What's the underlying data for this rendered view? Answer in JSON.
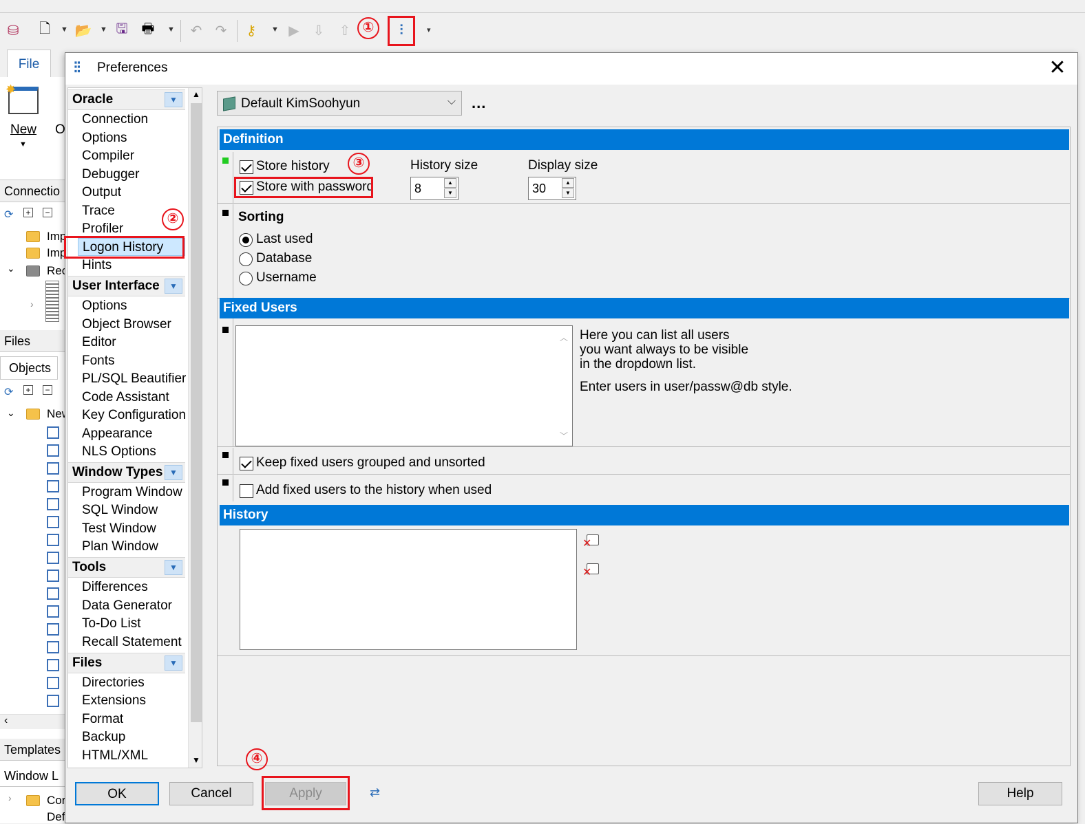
{
  "ribbon": {
    "file_tab": "File",
    "new_label": "New",
    "open_label_fragment": "O"
  },
  "left_panel": {
    "connections_title": "Connectio",
    "files_title": "Files",
    "objects_tab": "Objects",
    "templates_title": "Templates",
    "window_title": "Window L",
    "tree_items": [
      "Imp",
      "Imp",
      "Rec"
    ],
    "tree_items_2": [
      "New"
    ],
    "bottom_items": [
      "Cor",
      "Default"
    ]
  },
  "dialog": {
    "title": "Preferences",
    "close_glyph": "✕",
    "profile": "Default KimSoohyun",
    "profile_more": "...",
    "nav": [
      {
        "category": "Oracle",
        "items": [
          "Connection",
          "Options",
          "Compiler",
          "Debugger",
          "Output",
          "Trace",
          "Profiler",
          "Logon History",
          "Hints"
        ]
      },
      {
        "category": "User Interface",
        "items": [
          "Options",
          "Object Browser",
          "Editor",
          "Fonts",
          "PL/SQL Beautifier",
          "Code Assistant",
          "Key Configuration",
          "Appearance",
          "NLS Options"
        ]
      },
      {
        "category": "Window Types",
        "items": [
          "Program Window",
          "SQL Window",
          "Test Window",
          "Plan Window"
        ]
      },
      {
        "category": "Tools",
        "items": [
          "Differences",
          "Data Generator",
          "To-Do List",
          "Recall Statement"
        ]
      },
      {
        "category": "Files",
        "items": [
          "Directories",
          "Extensions",
          "Format",
          "Backup",
          "HTML/XML"
        ]
      }
    ],
    "selected_nav": "Logon History",
    "definition": {
      "header": "Definition",
      "store_history": "Store history",
      "store_history_checked": true,
      "store_with_password": "Store with password",
      "store_with_password_checked": true,
      "history_size_label": "History size",
      "history_size": "8",
      "display_size_label": "Display size",
      "display_size": "30"
    },
    "sorting": {
      "label": "Sorting",
      "options": [
        "Last used",
        "Database",
        "Username"
      ],
      "selected": "Last used"
    },
    "fixed_users": {
      "header": "Fixed Users",
      "help_line1": "Here you can list all users",
      "help_line2": "you want always to be visible",
      "help_line3": "in the dropdown list.",
      "help_line4": "Enter users in user/passw@db style.",
      "keep_grouped": "Keep fixed users grouped and unsorted",
      "keep_grouped_checked": true,
      "add_to_history": "Add fixed users to the history when used",
      "add_to_history_checked": false
    },
    "history": {
      "header": "History"
    },
    "buttons": {
      "ok": "OK",
      "cancel": "Cancel",
      "apply": "Apply",
      "help": "Help"
    }
  },
  "annotations": [
    "①",
    "②",
    "③",
    "④"
  ],
  "colors": {
    "accent": "#0078d7",
    "highlight": "#e8141c",
    "selection": "#cde8ff"
  }
}
